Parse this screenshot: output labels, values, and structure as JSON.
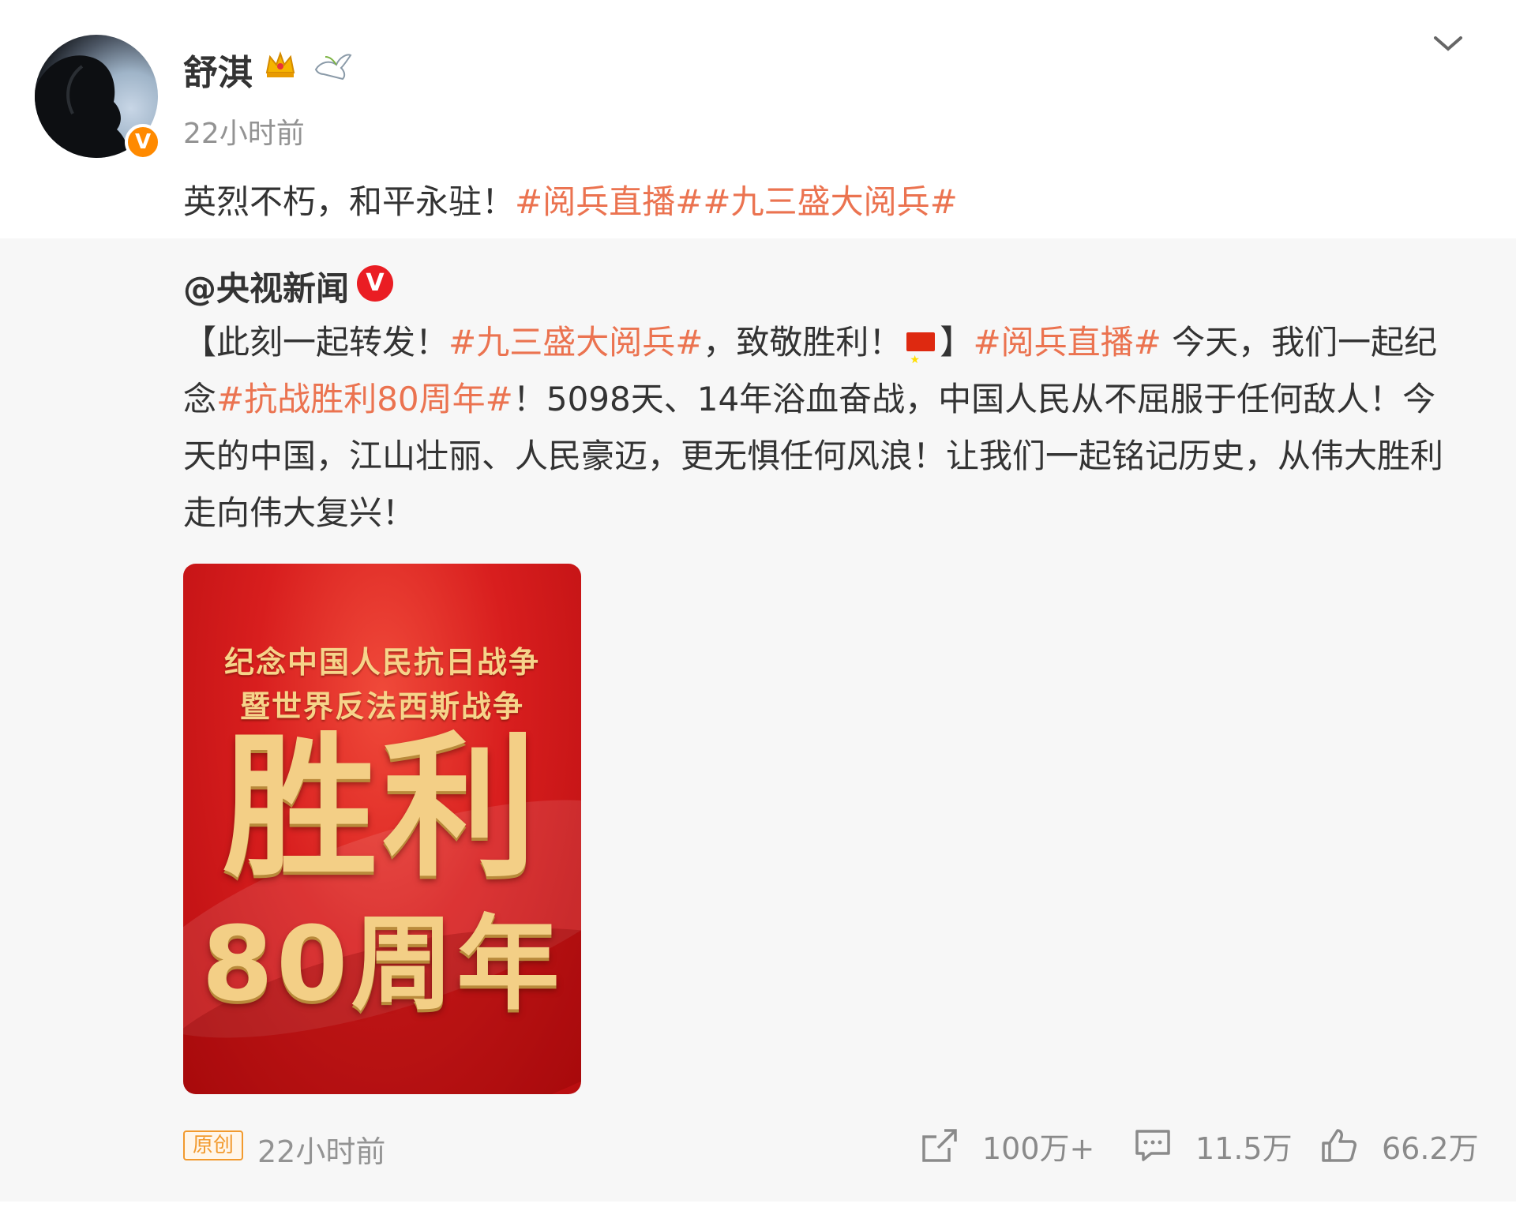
{
  "post": {
    "author": "舒淇",
    "time": "22小时前",
    "text_plain": "英烈不朽，和平永驻！",
    "text_tags": "#阅兵直播##九三盛大阅兵#",
    "badges": [
      "crown-icon",
      "dove-icon",
      "verified-icon"
    ]
  },
  "repost": {
    "author": "@央视新闻",
    "verified_mark": "V",
    "segments": [
      {
        "text": "【此刻一起转发！",
        "tag": false
      },
      {
        "text": "#九三盛大阅兵#",
        "tag": true
      },
      {
        "text": "，致敬胜利！",
        "tag": false
      },
      {
        "text": "】",
        "tag": false
      },
      {
        "text": "#阅兵直播#",
        "tag": true
      },
      {
        "text": " 今天，我们一起纪念",
        "tag": false
      },
      {
        "text": "#抗战胜利80周年#",
        "tag": true
      },
      {
        "text": "！5098天、14年浴血奋战，中国人民从不屈服于任何敌人！今天的中国，江山壮丽、人民豪迈，更无惧任何风浪！让我们一起铭记历史，从伟大胜利走向伟大复兴！",
        "tag": false
      }
    ],
    "poster": {
      "line1": "纪念中国人民抗日战争",
      "line2": "暨世界反法西斯战争",
      "big": "胜利",
      "years": "80周年"
    }
  },
  "footer": {
    "badge": "原创",
    "time": "22小时前",
    "reposts": "100万+",
    "comments": "11.5万",
    "likes": "66.2万"
  },
  "colors": {
    "hashtag": "#eb7350",
    "card_bg": "#f7f7f7",
    "badge_orange": "#f29a2e"
  }
}
